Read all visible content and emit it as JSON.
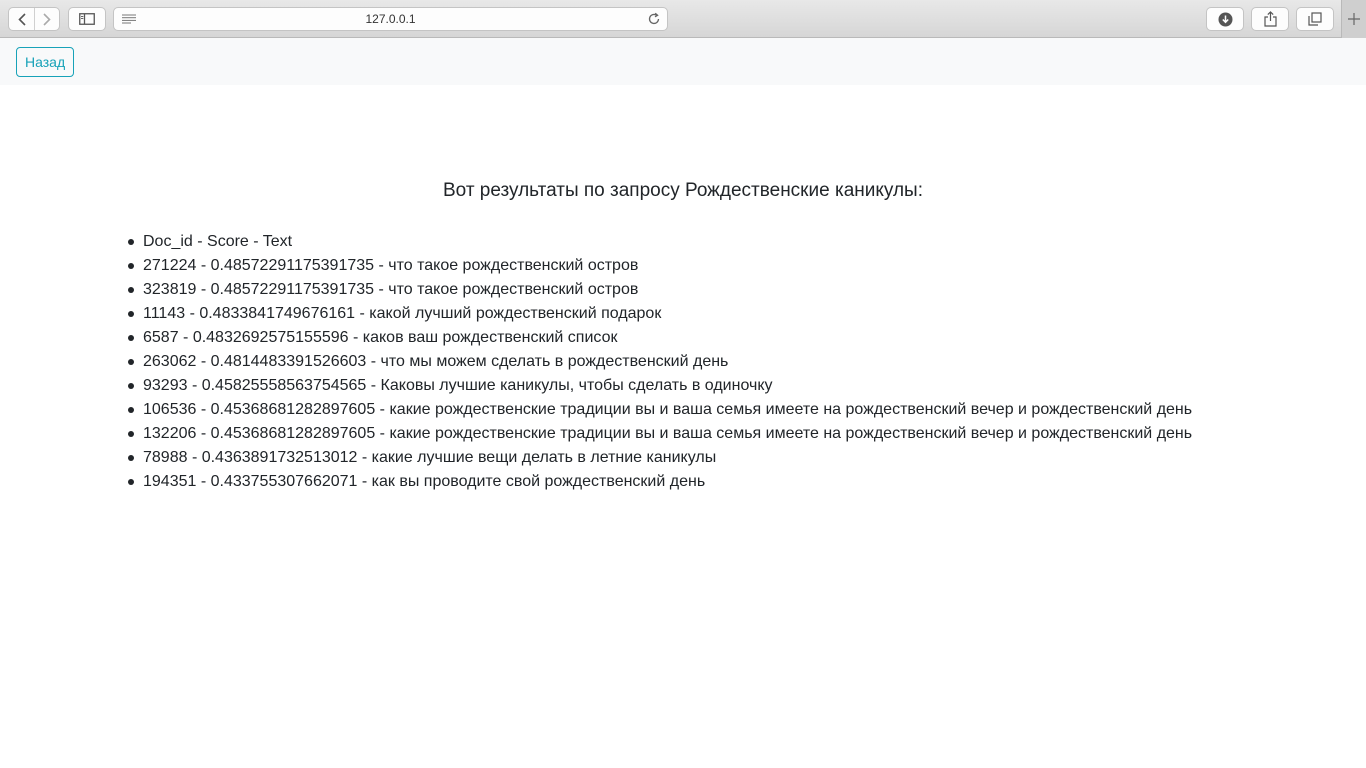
{
  "browser": {
    "url": "127.0.0.1",
    "icons": [
      "back-icon",
      "forward-icon",
      "sidebar-icon",
      "reader-icon",
      "reload-icon",
      "download-icon",
      "share-icon",
      "tabs-icon",
      "plus-icon"
    ]
  },
  "header": {
    "back_label": "Назад"
  },
  "main": {
    "title": "Вот результаты по запросу Рождественские каникулы:",
    "results": [
      "Doc_id - Score - Text",
      "271224 - 0.48572291175391735 - что такое рождественский остров",
      "323819 - 0.48572291175391735 - что такое рождественский остров",
      "11143 - 0.4833841749676161 - какой лучший рождественский подарок",
      "6587 - 0.4832692575155596 - каков ваш рождественский список",
      "263062 - 0.4814483391526603 - что мы можем сделать в рождественский день",
      "93293 - 0.45825558563754565 - Каковы лучшие каникулы, чтобы сделать в одиночку",
      "106536 - 0.45368681282897605 - какие рождественские традиции вы и ваша семья имеете на рождественский вечер и рождественский день",
      "132206 - 0.45368681282897605 - какие рождественские традиции вы и ваша семья имеете на рождественский вечер и рождественский день",
      "78988 - 0.4363891732513012 - какие лучшие вещи делать в летние каникулы",
      "194351 - 0.433755307662071 - как вы проводите свой рождественский день"
    ]
  },
  "colors": {
    "accent": "#17a2b8",
    "text": "#212529",
    "topbar_bg": "#f8f9fa"
  }
}
